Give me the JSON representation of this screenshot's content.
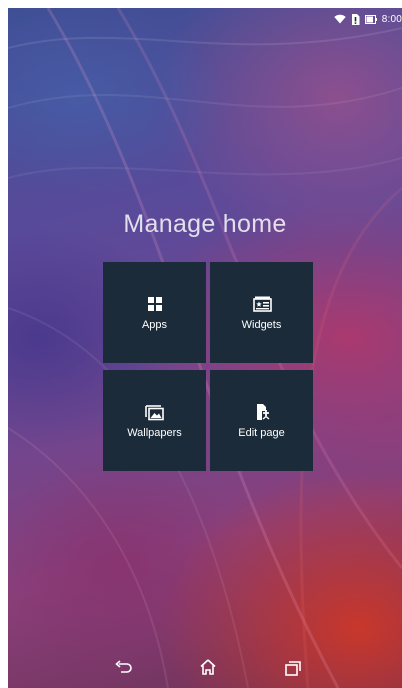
{
  "status_bar": {
    "time": "8:00",
    "icons": [
      "wifi-icon",
      "sim-no-signal-icon",
      "battery-icon"
    ]
  },
  "title": "Manage home",
  "tiles": [
    {
      "label": "Apps",
      "icon": "apps-grid-icon"
    },
    {
      "label": "Widgets",
      "icon": "widgets-icon"
    },
    {
      "label": "Wallpapers",
      "icon": "wallpapers-icon"
    },
    {
      "label": "Edit page",
      "icon": "edit-page-icon"
    }
  ],
  "nav": {
    "buttons": [
      "back-icon",
      "home-icon",
      "recents-icon"
    ]
  },
  "colors": {
    "tile_background": "#1c2b39",
    "text": "#ffffff"
  }
}
